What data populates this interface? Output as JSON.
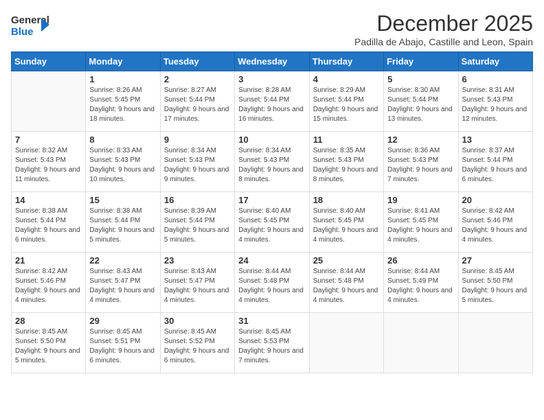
{
  "logo": {
    "line1": "General",
    "line2": "Blue"
  },
  "title": "December 2025",
  "subtitle": "Padilla de Abajo, Castille and Leon, Spain",
  "header": {
    "days": [
      "Sunday",
      "Monday",
      "Tuesday",
      "Wednesday",
      "Thursday",
      "Friday",
      "Saturday"
    ]
  },
  "weeks": [
    [
      {
        "day": "",
        "sunrise": "",
        "sunset": "",
        "daylight": ""
      },
      {
        "day": "1",
        "sunrise": "8:26 AM",
        "sunset": "5:45 PM",
        "hours": "9 hours and 18 minutes."
      },
      {
        "day": "2",
        "sunrise": "8:27 AM",
        "sunset": "5:44 PM",
        "hours": "9 hours and 17 minutes."
      },
      {
        "day": "3",
        "sunrise": "8:28 AM",
        "sunset": "5:44 PM",
        "hours": "9 hours and 16 minutes."
      },
      {
        "day": "4",
        "sunrise": "8:29 AM",
        "sunset": "5:44 PM",
        "hours": "9 hours and 15 minutes."
      },
      {
        "day": "5",
        "sunrise": "8:30 AM",
        "sunset": "5:44 PM",
        "hours": "9 hours and 13 minutes."
      },
      {
        "day": "6",
        "sunrise": "8:31 AM",
        "sunset": "5:43 PM",
        "hours": "9 hours and 12 minutes."
      }
    ],
    [
      {
        "day": "7",
        "sunrise": "8:32 AM",
        "sunset": "5:43 PM",
        "hours": "9 hours and 11 minutes."
      },
      {
        "day": "8",
        "sunrise": "8:33 AM",
        "sunset": "5:43 PM",
        "hours": "9 hours and 10 minutes."
      },
      {
        "day": "9",
        "sunrise": "8:34 AM",
        "sunset": "5:43 PM",
        "hours": "9 hours and 9 minutes."
      },
      {
        "day": "10",
        "sunrise": "8:34 AM",
        "sunset": "5:43 PM",
        "hours": "9 hours and 8 minutes."
      },
      {
        "day": "11",
        "sunrise": "8:35 AM",
        "sunset": "5:43 PM",
        "hours": "9 hours and 8 minutes."
      },
      {
        "day": "12",
        "sunrise": "8:36 AM",
        "sunset": "5:43 PM",
        "hours": "9 hours and 7 minutes."
      },
      {
        "day": "13",
        "sunrise": "8:37 AM",
        "sunset": "5:44 PM",
        "hours": "9 hours and 6 minutes."
      }
    ],
    [
      {
        "day": "14",
        "sunrise": "8:38 AM",
        "sunset": "5:44 PM",
        "hours": "9 hours and 6 minutes."
      },
      {
        "day": "15",
        "sunrise": "8:38 AM",
        "sunset": "5:44 PM",
        "hours": "9 hours and 5 minutes."
      },
      {
        "day": "16",
        "sunrise": "8:39 AM",
        "sunset": "5:44 PM",
        "hours": "9 hours and 5 minutes."
      },
      {
        "day": "17",
        "sunrise": "8:40 AM",
        "sunset": "5:45 PM",
        "hours": "9 hours and 4 minutes."
      },
      {
        "day": "18",
        "sunrise": "8:40 AM",
        "sunset": "5:45 PM",
        "hours": "9 hours and 4 minutes."
      },
      {
        "day": "19",
        "sunrise": "8:41 AM",
        "sunset": "5:45 PM",
        "hours": "9 hours and 4 minutes."
      },
      {
        "day": "20",
        "sunrise": "8:42 AM",
        "sunset": "5:46 PM",
        "hours": "9 hours and 4 minutes."
      }
    ],
    [
      {
        "day": "21",
        "sunrise": "8:42 AM",
        "sunset": "5:46 PM",
        "hours": "9 hours and 4 minutes."
      },
      {
        "day": "22",
        "sunrise": "8:43 AM",
        "sunset": "5:47 PM",
        "hours": "9 hours and 4 minutes."
      },
      {
        "day": "23",
        "sunrise": "8:43 AM",
        "sunset": "5:47 PM",
        "hours": "9 hours and 4 minutes."
      },
      {
        "day": "24",
        "sunrise": "8:44 AM",
        "sunset": "5:48 PM",
        "hours": "9 hours and 4 minutes."
      },
      {
        "day": "25",
        "sunrise": "8:44 AM",
        "sunset": "5:48 PM",
        "hours": "9 hours and 4 minutes."
      },
      {
        "day": "26",
        "sunrise": "8:44 AM",
        "sunset": "5:49 PM",
        "hours": "9 hours and 4 minutes."
      },
      {
        "day": "27",
        "sunrise": "8:45 AM",
        "sunset": "5:50 PM",
        "hours": "9 hours and 5 minutes."
      }
    ],
    [
      {
        "day": "28",
        "sunrise": "8:45 AM",
        "sunset": "5:50 PM",
        "hours": "9 hours and 5 minutes."
      },
      {
        "day": "29",
        "sunrise": "8:45 AM",
        "sunset": "5:51 PM",
        "hours": "9 hours and 6 minutes."
      },
      {
        "day": "30",
        "sunrise": "8:45 AM",
        "sunset": "5:52 PM",
        "hours": "9 hours and 6 minutes."
      },
      {
        "day": "31",
        "sunrise": "8:45 AM",
        "sunset": "5:53 PM",
        "hours": "9 hours and 7 minutes."
      },
      {
        "day": "",
        "sunrise": "",
        "sunset": "",
        "hours": ""
      },
      {
        "day": "",
        "sunrise": "",
        "sunset": "",
        "hours": ""
      },
      {
        "day": "",
        "sunrise": "",
        "sunset": "",
        "hours": ""
      }
    ]
  ],
  "labels": {
    "sunrise": "Sunrise:",
    "sunset": "Sunset:",
    "daylight": "Daylight:"
  }
}
